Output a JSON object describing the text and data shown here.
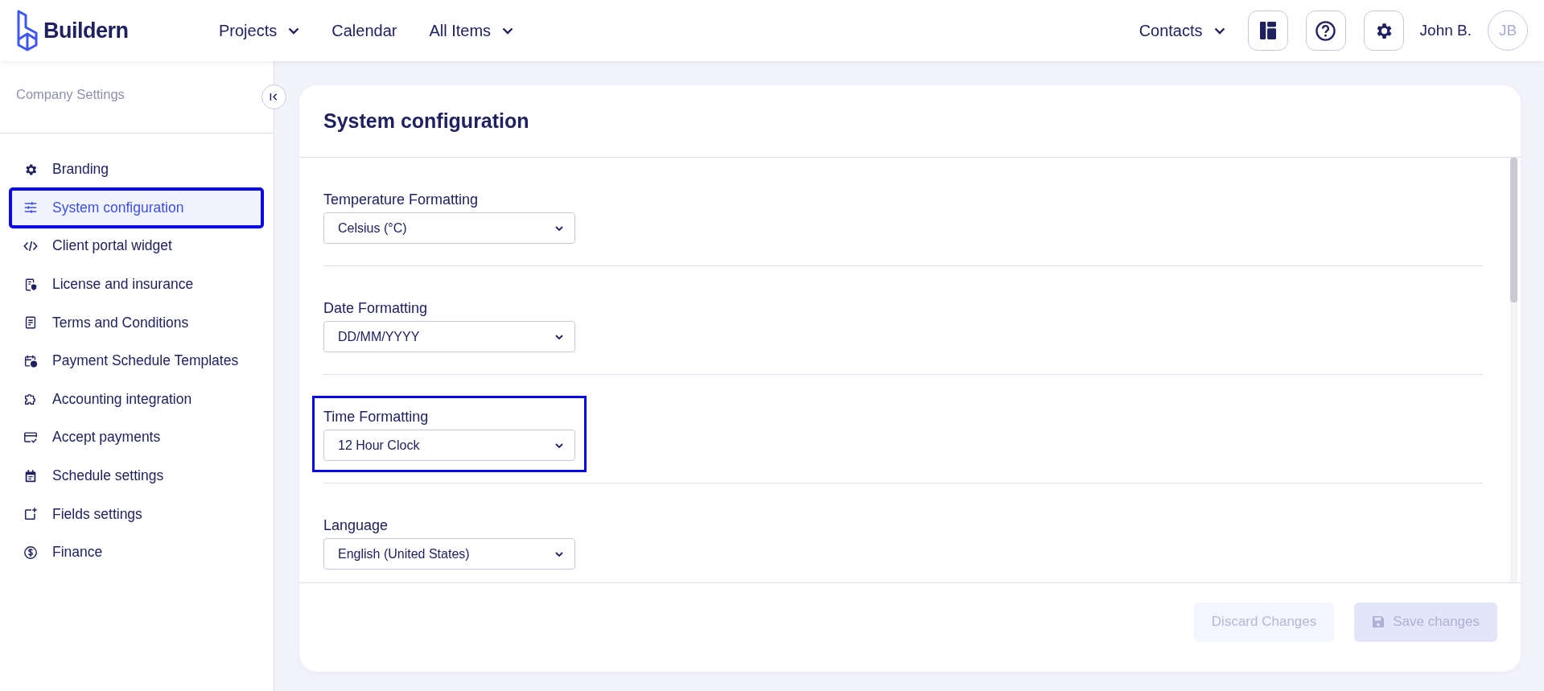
{
  "header": {
    "logo": "Buildern",
    "nav": [
      {
        "label": "Projects",
        "kind": "menu"
      },
      {
        "label": "Calendar",
        "kind": "link"
      },
      {
        "label": "All Items",
        "kind": "menu"
      }
    ],
    "contacts": {
      "label": "Contacts"
    },
    "user": {
      "name": "John B.",
      "initials": "JB"
    }
  },
  "sidebar": {
    "title": "Company Settings",
    "items": [
      {
        "label": "Branding",
        "selected": false,
        "highlighted": false
      },
      {
        "label": "System configuration",
        "selected": true,
        "highlighted": true
      },
      {
        "label": "Client portal widget",
        "selected": false,
        "highlighted": false
      },
      {
        "label": "License and insurance",
        "selected": false,
        "highlighted": false
      },
      {
        "label": "Terms and Conditions",
        "selected": false,
        "highlighted": false
      },
      {
        "label": "Payment Schedule Templates",
        "selected": false,
        "highlighted": false
      },
      {
        "label": "Accounting integration",
        "selected": false,
        "highlighted": false
      },
      {
        "label": "Accept payments",
        "selected": false,
        "highlighted": false
      },
      {
        "label": "Schedule settings",
        "selected": false,
        "highlighted": false
      },
      {
        "label": "Fields settings",
        "selected": false,
        "highlighted": false
      },
      {
        "label": "Finance",
        "selected": false,
        "highlighted": false
      }
    ]
  },
  "panel": {
    "title": "System configuration",
    "fields": [
      {
        "label": "Temperature Formatting",
        "value": "Celsius (°C)",
        "highlighted": false
      },
      {
        "label": "Date Formatting",
        "value": "DD/MM/YYYY",
        "highlighted": false
      },
      {
        "label": "Time Formatting",
        "value": "12 Hour Clock",
        "highlighted": true
      },
      {
        "label": "Language",
        "value": "English (United States)",
        "highlighted": false
      }
    ],
    "buttons": [
      {
        "label": "Discard Changes",
        "kind": "secondary",
        "disabled": true
      },
      {
        "label": "Save changes",
        "kind": "primary",
        "disabled": true
      }
    ]
  }
}
